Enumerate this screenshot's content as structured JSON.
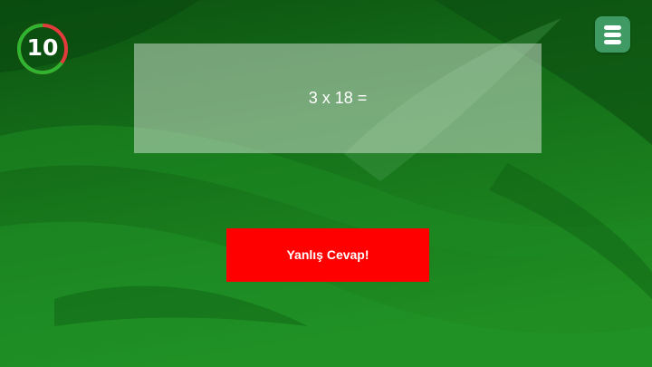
{
  "timer": {
    "value": "10",
    "remaining_fraction": 0.65,
    "ring_color": "#2fb52f",
    "elapsed_color": "#e23b3b"
  },
  "menu": {
    "icon": "menu-icon"
  },
  "question": {
    "text": "3 x 18 ="
  },
  "feedback": {
    "text": "Yanlış Cevap!",
    "color": "#ff0000"
  },
  "colors": {
    "background_dark": "#0a4a10",
    "background_light": "#1f8f24",
    "menu_button": "#3f9b63"
  }
}
